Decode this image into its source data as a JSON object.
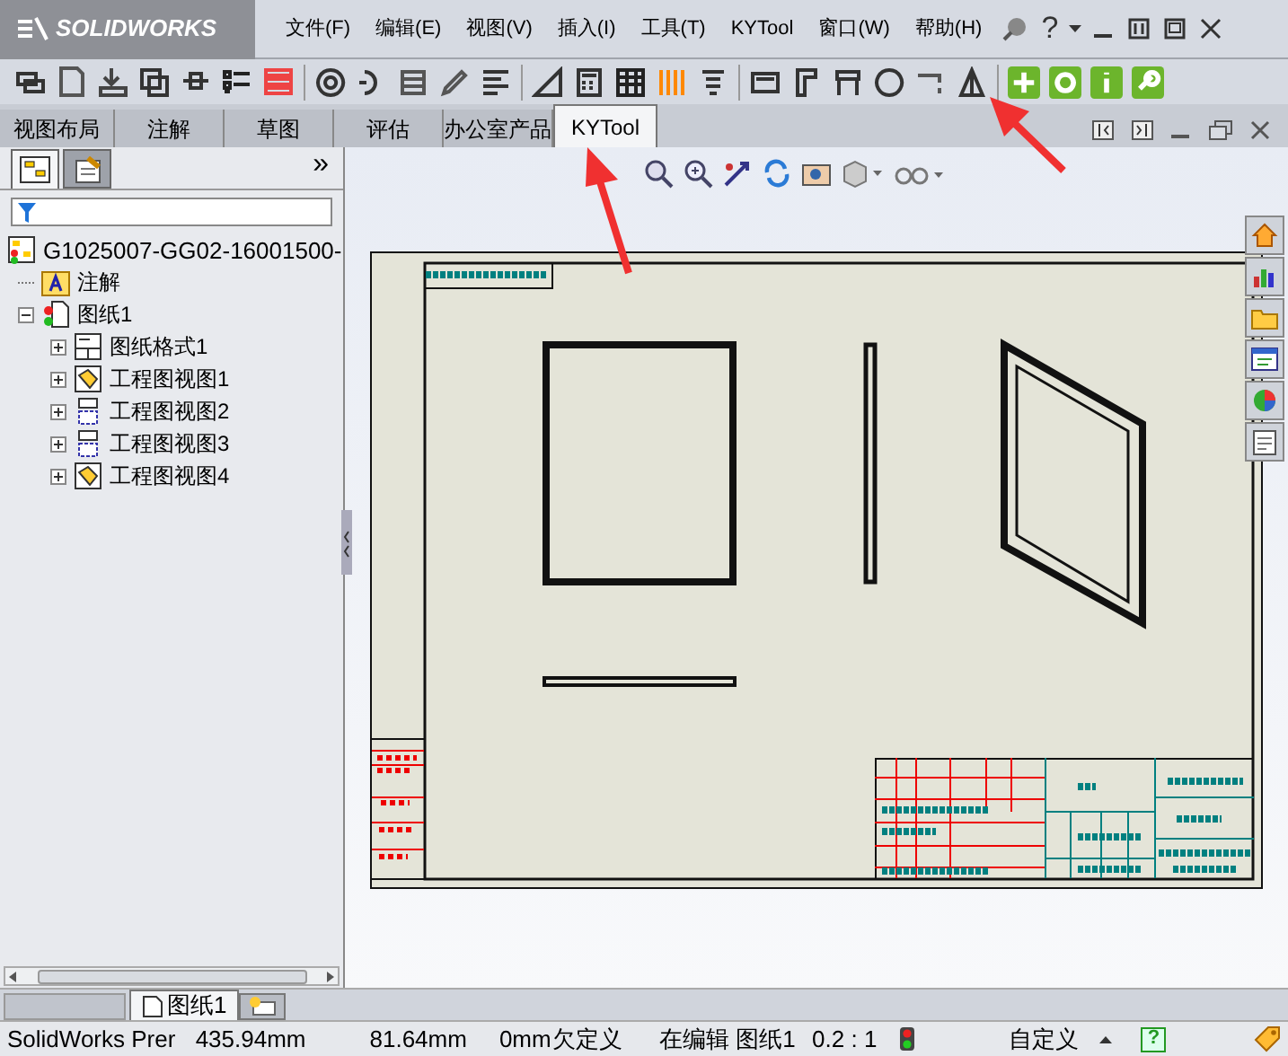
{
  "app_logo": "SOLIDWORKS",
  "menu": [
    "文件(F)",
    "编辑(E)",
    "视图(V)",
    "插入(I)",
    "工具(T)",
    "KYTool",
    "窗口(W)",
    "帮助(H)"
  ],
  "help_glyph": "?",
  "command_tabs": [
    {
      "label": "视图布局",
      "selected": false
    },
    {
      "label": "注解",
      "selected": false
    },
    {
      "label": "草图",
      "selected": false
    },
    {
      "label": "评估",
      "selected": false
    },
    {
      "label": "办公室产品",
      "selected": false
    },
    {
      "label": "KYTool",
      "selected": true
    }
  ],
  "panel_tabs": [
    {
      "selected": true
    },
    {
      "selected": false
    }
  ],
  "panel_more": "»",
  "tree": {
    "label": "G1025007-GG02-16001500-",
    "kind": "drawing",
    "children": [
      {
        "label": "注解",
        "kind": "annotation"
      },
      {
        "label": "图纸1",
        "kind": "sheet",
        "expanded": true,
        "children": [
          {
            "label": "图纸格式1",
            "kind": "format",
            "expanded": false
          },
          {
            "label": "工程图视图1",
            "kind": "view3d",
            "expanded": false
          },
          {
            "label": "工程图视图2",
            "kind": "view",
            "expanded": false
          },
          {
            "label": "工程图视图3",
            "kind": "view",
            "expanded": false
          },
          {
            "label": "工程图视图4",
            "kind": "view3d",
            "expanded": false
          }
        ]
      }
    ]
  },
  "sheet_tabs": [
    {
      "label": "图纸1",
      "selected": true
    }
  ],
  "status_bar": {
    "product": "SolidWorks Prer",
    "x": "435.94mm",
    "y": "81.64mm",
    "z": "0mm",
    "constraint": "欠定义",
    "editing": "在编辑 图纸1",
    "scale": "0.2 : 1",
    "units": "自定义",
    "help": "?"
  }
}
